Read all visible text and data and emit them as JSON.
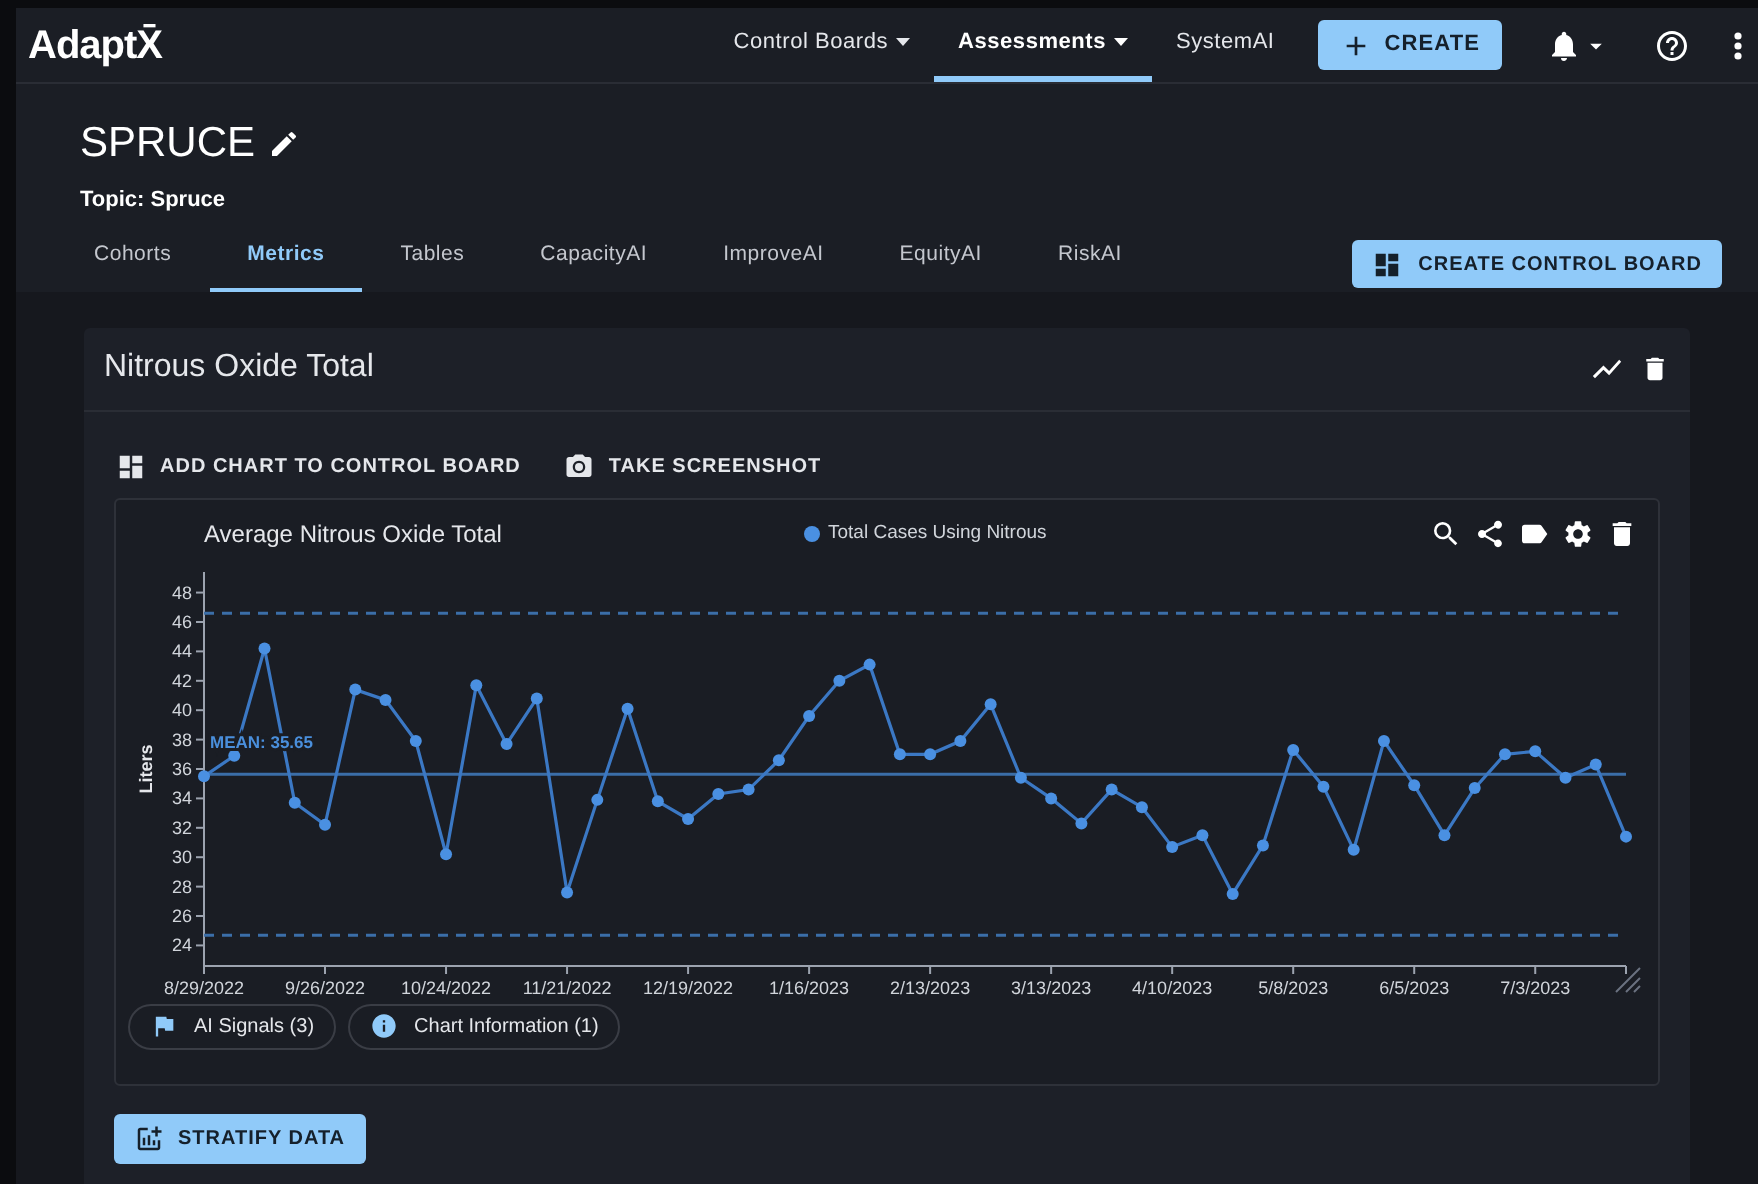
{
  "nav": {
    "logo": "AdaptX̄",
    "items": [
      {
        "label": "Control Boards",
        "dropdown": true,
        "selected": false
      },
      {
        "label": "Assessments",
        "dropdown": true,
        "selected": true
      },
      {
        "label": "SystemAI",
        "dropdown": false,
        "selected": false
      }
    ],
    "create_button": "CREATE"
  },
  "header": {
    "title": "SPRUCE",
    "topic": "Topic: Spruce",
    "create_control_board_button": "CREATE CONTROL BOARD"
  },
  "tabs": [
    {
      "label": "Cohorts",
      "selected": false
    },
    {
      "label": "Metrics",
      "selected": true
    },
    {
      "label": "Tables",
      "selected": false
    },
    {
      "label": "CapacityAI",
      "selected": false
    },
    {
      "label": "ImproveAI",
      "selected": false
    },
    {
      "label": "EquityAI",
      "selected": false
    },
    {
      "label": "RiskAI",
      "selected": false
    }
  ],
  "metric_card": {
    "title": "Nitrous Oxide Total",
    "actions": [
      {
        "kind": "add",
        "label": "ADD CHART TO CONTROL BOARD"
      },
      {
        "kind": "screenshot",
        "label": "TAKE SCREENSHOT"
      }
    ],
    "chart": {
      "chart_data": {
        "type": "line",
        "title": "Average Nitrous Oxide Total",
        "ylabel": "Liters",
        "categories": [
          "8/29/2022",
          null,
          null,
          null,
          "9/26/2022",
          null,
          null,
          null,
          "10/24/2022",
          null,
          null,
          null,
          "11/21/2022",
          null,
          null,
          null,
          "12/19/2022",
          null,
          null,
          null,
          "1/16/2023",
          null,
          null,
          null,
          "2/13/2023",
          null,
          null,
          null,
          "3/13/2023",
          null,
          null,
          null,
          "4/10/2023",
          null,
          null,
          null,
          "5/8/2023",
          null,
          null,
          null,
          "6/5/2023",
          null,
          null,
          null,
          "7/3/2023",
          null,
          null,
          null
        ],
        "series": [
          {
            "name": "Total Cases Using Nitrous",
            "color": "#4a90e2",
            "marker": "circle",
            "values": [
              35.5,
              36.9,
              44.2,
              33.7,
              32.2,
              41.4,
              40.7,
              37.9,
              30.2,
              41.7,
              37.7,
              40.8,
              27.6,
              33.9,
              40.1,
              33.8,
              32.6,
              34.3,
              34.6,
              36.6,
              39.6,
              42.0,
              43.1,
              37.0,
              37.0,
              37.9,
              40.4,
              35.4,
              34.0,
              32.3,
              34.6,
              33.4,
              30.7,
              31.5,
              27.5,
              30.8,
              37.3,
              34.8,
              30.5,
              37.9,
              34.9,
              31.5,
              34.7,
              37.0,
              37.2,
              35.4,
              36.3,
              31.4
            ]
          }
        ],
        "ylim": [
          22.6,
          49.4
        ],
        "yticks": [
          24,
          26,
          28,
          30,
          32,
          34,
          36,
          38,
          40,
          42,
          44,
          46,
          48
        ],
        "ref_lines": [
          {
            "axis": "y",
            "value": 35.65,
            "label": "MEAN: 35.65",
            "color": "#3b6ea8"
          },
          {
            "axis": "y",
            "value": 46.6,
            "color": "#3b6ea8"
          },
          {
            "axis": "y",
            "value": 24.7,
            "color": "#3b6ea8"
          }
        ]
      },
      "chips": [
        {
          "kind": "signals",
          "label": "AI Signals (3)"
        },
        {
          "kind": "info",
          "label": "Chart Information (1)"
        }
      ]
    },
    "stratify_button": "STRATIFY DATA"
  }
}
